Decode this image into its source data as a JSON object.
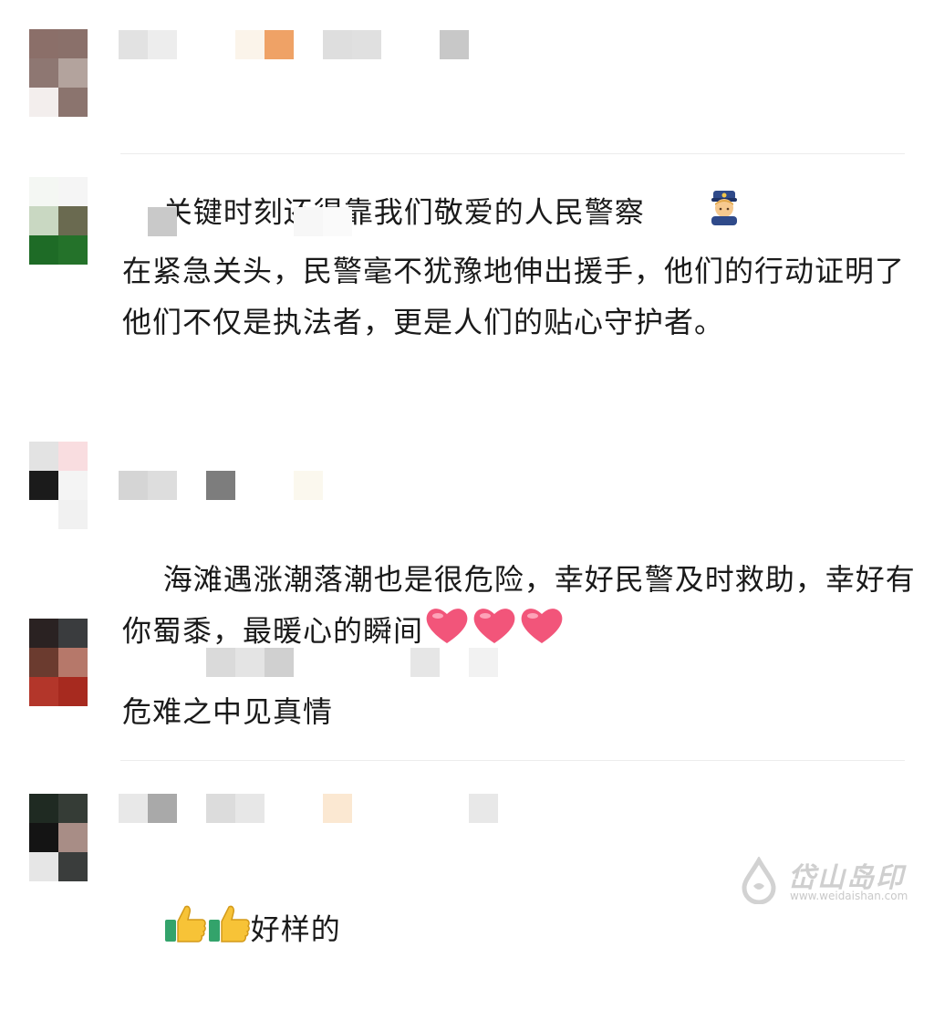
{
  "comments": [
    {
      "text": "关键时刻还得靠我们敬爱的人民警察",
      "trailing_emoji": "police-officer"
    },
    {
      "text": "在紧急关头，民警毫不犹豫地伸出援手，他们的行动证明了他们不仅是执法者，更是人们的贴心守护者。"
    },
    {
      "text": "海滩遇涨潮落潮也是很危险，幸好民警及时救助，幸好有你蜀黍，最暖心的瞬间",
      "trailing_emoji": "pink-heart x3"
    },
    {
      "text": "危难之中见真情"
    },
    {
      "text": "好样的",
      "leading_emoji": "thumbs-up x2"
    }
  ],
  "watermark": {
    "title": "岱山岛印",
    "url": "www.weidaishan.com"
  }
}
